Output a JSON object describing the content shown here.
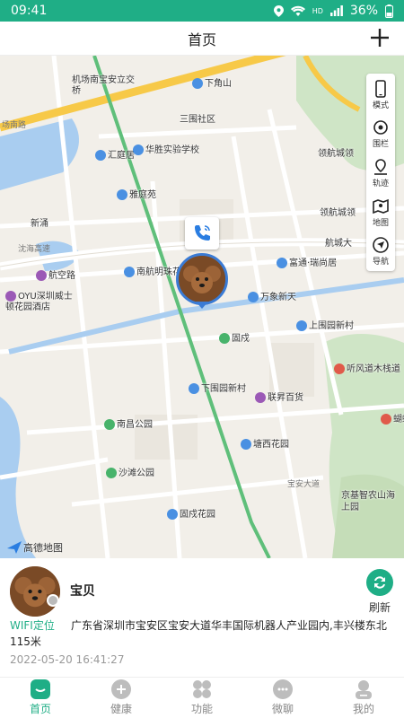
{
  "status_bar": {
    "time": "09:41",
    "network": "HD",
    "battery": "36%"
  },
  "header": {
    "title": "首页",
    "add_icon": "plus-icon"
  },
  "map": {
    "pois": [
      {
        "name": "机场南宝安立交桥",
        "kind": "nopin"
      },
      {
        "name": "下角山",
        "kind": "blue"
      },
      {
        "name": "三围社区",
        "kind": "nopin"
      },
      {
        "name": "汇庭居",
        "kind": "blue"
      },
      {
        "name": "华胜实验学校",
        "kind": "blue"
      },
      {
        "name": "领航城领",
        "kind": "nopin"
      },
      {
        "name": "雅庭苑",
        "kind": "blue"
      },
      {
        "name": "新涌",
        "kind": "nopin"
      },
      {
        "name": "领航城领",
        "kind": "nopin"
      },
      {
        "name": "航城大",
        "kind": "nopin"
      },
      {
        "name": "航空路",
        "kind": "purple"
      },
      {
        "name": "南航明珠花",
        "kind": "blue"
      },
      {
        "name": "富通·瑞尚居",
        "kind": "blue"
      },
      {
        "name": "OYU深圳威士顿花园酒店",
        "kind": "purple"
      },
      {
        "name": "万象新天",
        "kind": "blue"
      },
      {
        "name": "固戍",
        "kind": "green"
      },
      {
        "name": "上围园新村",
        "kind": "blue"
      },
      {
        "name": "听风道木栈道",
        "kind": "red"
      },
      {
        "name": "下围园新村",
        "kind": "blue"
      },
      {
        "name": "联昇百货",
        "kind": "purple"
      },
      {
        "name": "南昌公园",
        "kind": "green"
      },
      {
        "name": "蝴蝶",
        "kind": "red"
      },
      {
        "name": "塘西花园",
        "kind": "blue"
      },
      {
        "name": "沙滩公园",
        "kind": "green"
      },
      {
        "name": "京基智农山海上园",
        "kind": "nopin"
      },
      {
        "name": "固戍花园",
        "kind": "blue"
      }
    ],
    "roads": [
      "场南路",
      "沈海高速",
      "宝安大道"
    ],
    "logo_text": "高德地图",
    "tools": [
      {
        "label": "模式",
        "icon": "phone-mode-icon"
      },
      {
        "label": "围栏",
        "icon": "fence-icon"
      },
      {
        "label": "轨迹",
        "icon": "track-icon"
      },
      {
        "label": "地图",
        "icon": "map-icon"
      },
      {
        "label": "导航",
        "icon": "navigation-icon"
      }
    ]
  },
  "pet": {
    "name": "宝贝",
    "refresh_label": "刷新",
    "location_type": "WIFI定位",
    "address": "广东省深圳市宝安区宝安大道华丰国际机器人产业园内,丰兴楼东北115米",
    "timestamp": "2022-05-20 16:41:27"
  },
  "nav": [
    {
      "label": "首页",
      "icon": "home-icon",
      "active": true
    },
    {
      "label": "健康",
      "icon": "health-icon",
      "active": false
    },
    {
      "label": "功能",
      "icon": "grid-icon",
      "active": false
    },
    {
      "label": "微聊",
      "icon": "chat-icon",
      "active": false
    },
    {
      "label": "我的",
      "icon": "profile-icon",
      "active": false
    }
  ],
  "colors": {
    "accent": "#1fae86",
    "marker": "#3a7bd5"
  }
}
